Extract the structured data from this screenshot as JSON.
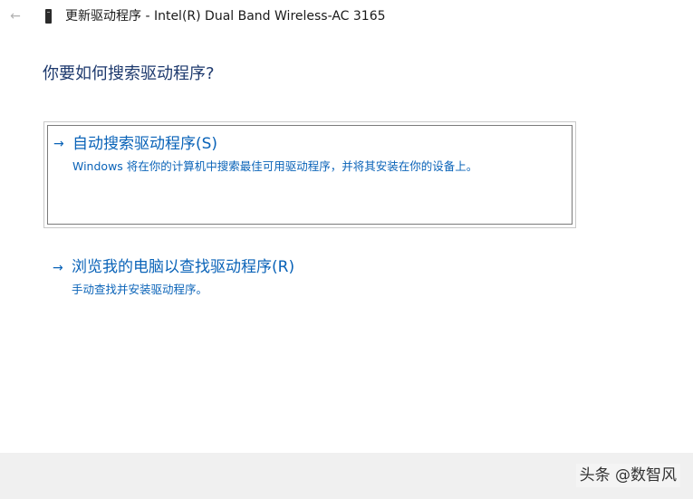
{
  "window": {
    "title": "更新驱动程序 - Intel(R) Dual Band Wireless-AC 3165",
    "back_icon": "back-arrow-icon",
    "device_icon": "device-icon"
  },
  "main": {
    "heading": "你要如何搜索驱动程序?"
  },
  "options": [
    {
      "arrow": "→",
      "title": "自动搜索驱动程序(S)",
      "description": "Windows 将在你的计算机中搜索最佳可用驱动程序，并将其安装在你的设备上。",
      "focused": true
    },
    {
      "arrow": "→",
      "title": "浏览我的电脑以查找驱动程序(R)",
      "description": "手动查找并安装驱动程序。",
      "focused": false
    }
  ],
  "footer": {
    "watermark": "头条 @数智风"
  },
  "colors": {
    "link": "#0a63b8",
    "heading": "#1e3a6e",
    "footer_bg": "#f0f0f0"
  }
}
